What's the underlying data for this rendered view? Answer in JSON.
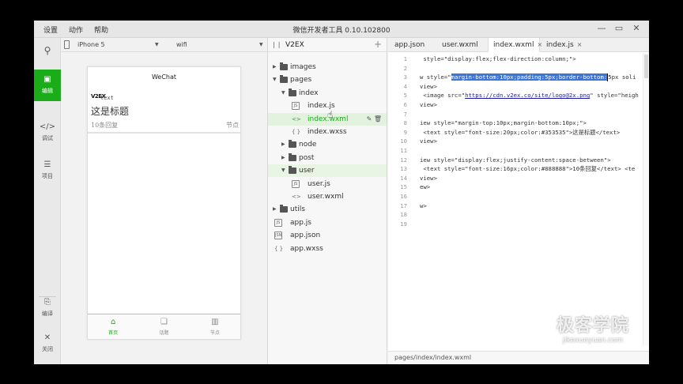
{
  "app": {
    "menu": [
      "设置",
      "动作",
      "帮助"
    ],
    "title": "微信开发者工具 0.10.102800",
    "controls": [
      "—",
      "▭",
      "✕"
    ]
  },
  "leftnav": {
    "items": [
      {
        "label": "编辑",
        "glyph": "▣",
        "active": true
      },
      {
        "label": "调试",
        "glyph": "</>",
        "active": false
      },
      {
        "label": "项目",
        "glyph": "☰",
        "active": false
      },
      {
        "label": "编译",
        "glyph": "⎘",
        "active": false
      },
      {
        "label": "关闭",
        "glyph": "✕",
        "active": false
      }
    ]
  },
  "device": {
    "model": "iPhone 5",
    "network": "wifi"
  },
  "phone": {
    "nav_title": "WeChat",
    "logo_text": "text",
    "title": "这是标题",
    "reply": "10条回复",
    "node": "节点",
    "tabbar": [
      {
        "label": "首页",
        "glyph": "⌂",
        "active": true
      },
      {
        "label": "话题",
        "glyph": "❏",
        "active": false
      },
      {
        "label": "节点",
        "glyph": "▥",
        "active": false
      }
    ]
  },
  "tree": {
    "project": "V2EX",
    "nodes": [
      {
        "depth": 0,
        "kind": "folder",
        "open": false,
        "name": "images"
      },
      {
        "depth": 0,
        "kind": "folder",
        "open": true,
        "name": "pages"
      },
      {
        "depth": 1,
        "kind": "folder",
        "open": true,
        "name": "index"
      },
      {
        "depth": 2,
        "kind": "js",
        "name": "index.js"
      },
      {
        "depth": 2,
        "kind": "wxml",
        "name": "index.wxml",
        "selected": true
      },
      {
        "depth": 2,
        "kind": "wxss",
        "name": "index.wxss"
      },
      {
        "depth": 1,
        "kind": "folder",
        "open": false,
        "name": "node"
      },
      {
        "depth": 1,
        "kind": "folder",
        "open": false,
        "name": "post"
      },
      {
        "depth": 1,
        "kind": "folder",
        "open": true,
        "name": "user",
        "highlight": true
      },
      {
        "depth": 2,
        "kind": "js",
        "name": "user.js"
      },
      {
        "depth": 2,
        "kind": "wxml",
        "name": "user.wxml"
      },
      {
        "depth": 0,
        "kind": "folder",
        "open": false,
        "name": "utils"
      },
      {
        "depth": 0,
        "kind": "js",
        "name": "app.js"
      },
      {
        "depth": 0,
        "kind": "json",
        "name": "app.json"
      },
      {
        "depth": 0,
        "kind": "wxss",
        "name": "app.wxss"
      }
    ]
  },
  "editor": {
    "tabs": [
      {
        "name": "app.json",
        "active": false,
        "closable": false
      },
      {
        "name": "user.wxml",
        "active": false,
        "closable": false
      },
      {
        "name": "index.wxml",
        "active": true,
        "closable": true
      },
      {
        "name": "index.js",
        "active": false,
        "closable": true
      }
    ],
    "lines": [
      {
        "n": "1",
        "code": " style=\"display:flex;flex-direction:column;\">"
      },
      {
        "n": "2",
        "code": ""
      },
      {
        "n": "3",
        "code": "w style=\"",
        "sel": "margin-bottom:10px;padding:5px;border-bottom:",
        "tail": "5px soli"
      },
      {
        "n": "4",
        "code": "view>"
      },
      {
        "n": "5",
        "code": " <image src=\"",
        "url": "https://cdn.v2ex.co/site/logo@2x.png",
        "tail": "\" style=\"heigh"
      },
      {
        "n": "6",
        "code": "view>"
      },
      {
        "n": "7",
        "code": ""
      },
      {
        "n": "8",
        "code": "iew style=\"margin-top:10px;margin-bottom:10px;\">"
      },
      {
        "n": "9",
        "code": " <text style=\"font-size:20px;color:#353535\">这是标题</text>"
      },
      {
        "n": "10",
        "code": "view>"
      },
      {
        "n": "11",
        "code": ""
      },
      {
        "n": "12",
        "code": "iew style=\"display:flex;justify-content:space-between\">"
      },
      {
        "n": "13",
        "code": " <text style=\"font-size:16px;color:#888888\">10条回复</text> <te"
      },
      {
        "n": "14",
        "code": "view>"
      },
      {
        "n": "15",
        "code": "ew>"
      },
      {
        "n": "16",
        "code": ""
      },
      {
        "n": "17",
        "code": "w>"
      },
      {
        "n": "18",
        "code": ""
      },
      {
        "n": "19",
        "code": ""
      }
    ],
    "status_path": "pages/index/index.wxml"
  },
  "watermark": {
    "main": "极客学院",
    "sub": "jikexueyuan.com"
  },
  "colors": {
    "accent": "#1aad19",
    "selection": "#3b76d6",
    "code_keyword": "#1a1aa6"
  }
}
